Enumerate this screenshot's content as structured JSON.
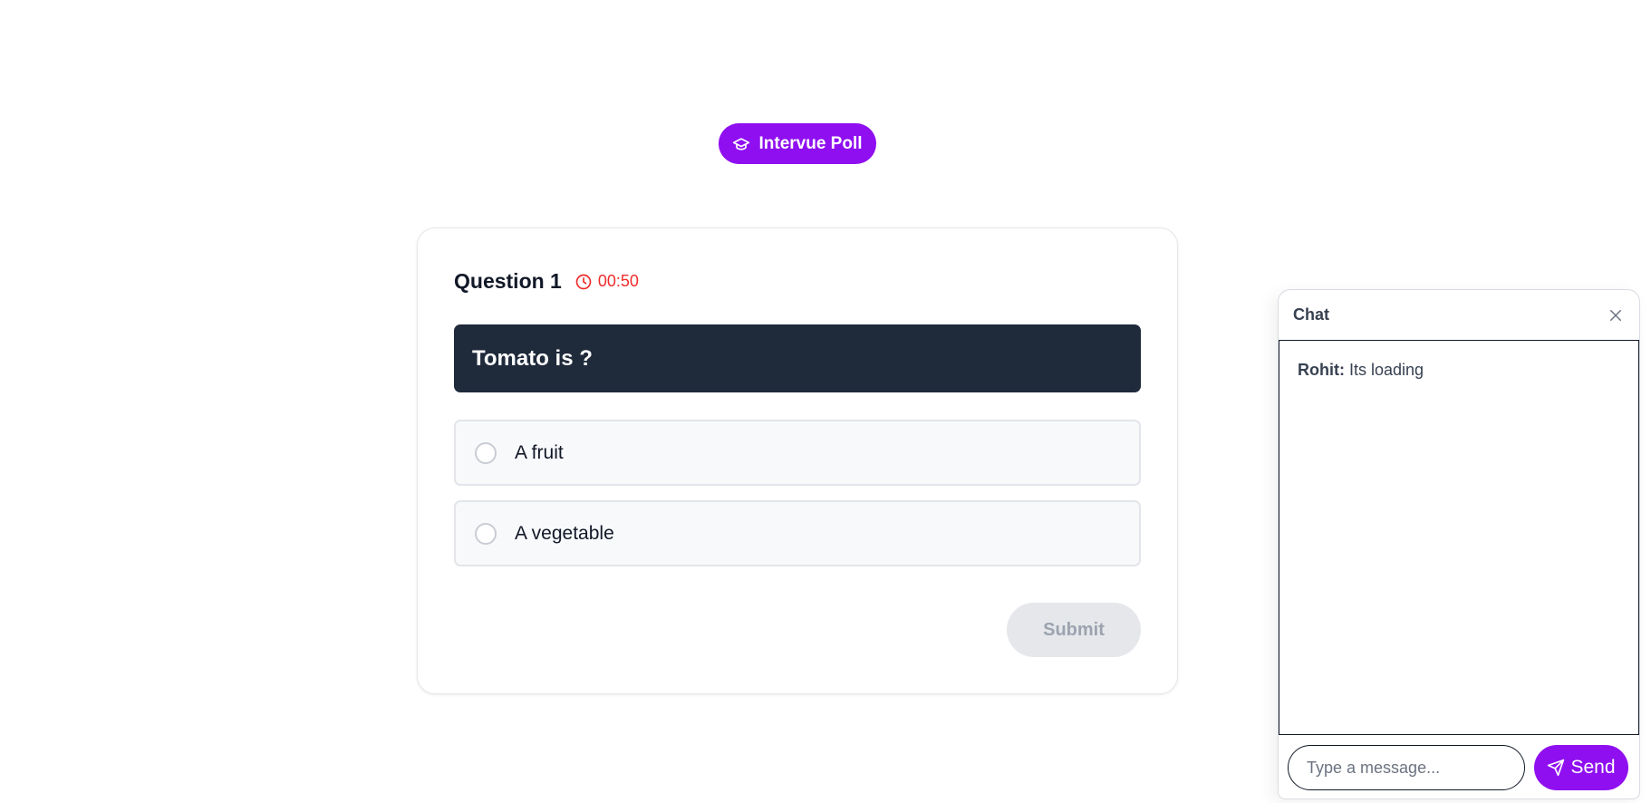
{
  "brand": {
    "label": "Intervue Poll",
    "icon": "graduation-cap-icon",
    "color": "#8f0ff0"
  },
  "poll": {
    "question_label": "Question 1",
    "timer": "00:50",
    "timer_color": "#ef2b2b",
    "question_text": "Tomato is ?",
    "options": [
      {
        "label": "A fruit",
        "selected": false
      },
      {
        "label": "A vegetable",
        "selected": false
      }
    ],
    "submit_label": "Submit",
    "submit_enabled": false
  },
  "chat": {
    "title": "Chat",
    "messages": [
      {
        "sender": "Rohit:",
        "text": " Its loading"
      }
    ],
    "input_placeholder": "Type a message...",
    "input_value": "",
    "send_label": "Send"
  }
}
